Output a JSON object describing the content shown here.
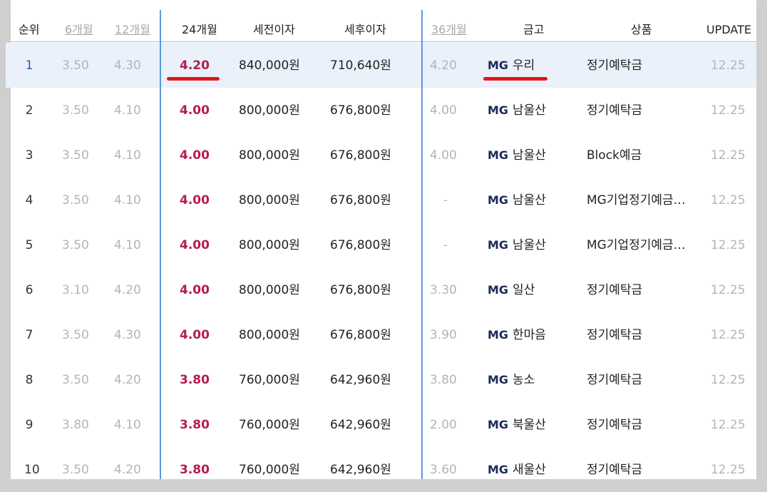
{
  "columns": {
    "rank": "순위",
    "m6": "6개월",
    "m12": "12개월",
    "m24": "24개월",
    "pretax": "세전이자",
    "aftertax": "세후이자",
    "m36": "36개월",
    "bank": "금고",
    "product": "상품",
    "update": "UPDATE"
  },
  "rows": [
    {
      "rank": "1",
      "m6": "3.50",
      "m12": "4.30",
      "m24": "4.20",
      "pretax": "840,000원",
      "aftertax": "710,640원",
      "m36": "4.20",
      "logo": "MG",
      "bank": "우리",
      "product": "정기예탁금",
      "update": "12.25"
    },
    {
      "rank": "2",
      "m6": "3.50",
      "m12": "4.10",
      "m24": "4.00",
      "pretax": "800,000원",
      "aftertax": "676,800원",
      "m36": "4.00",
      "logo": "MG",
      "bank": "남울산",
      "product": "정기예탁금",
      "update": "12.25"
    },
    {
      "rank": "3",
      "m6": "3.50",
      "m12": "4.10",
      "m24": "4.00",
      "pretax": "800,000원",
      "aftertax": "676,800원",
      "m36": "4.00",
      "logo": "MG",
      "bank": "남울산",
      "product": "Block예금",
      "update": "12.25"
    },
    {
      "rank": "4",
      "m6": "3.50",
      "m12": "4.10",
      "m24": "4.00",
      "pretax": "800,000원",
      "aftertax": "676,800원",
      "m36": "-",
      "logo": "MG",
      "bank": "남울산",
      "product": "MG기업정기예금…",
      "update": "12.25"
    },
    {
      "rank": "5",
      "m6": "3.50",
      "m12": "4.10",
      "m24": "4.00",
      "pretax": "800,000원",
      "aftertax": "676,800원",
      "m36": "-",
      "logo": "MG",
      "bank": "남울산",
      "product": "MG기업정기예금…",
      "update": "12.25"
    },
    {
      "rank": "6",
      "m6": "3.10",
      "m12": "4.20",
      "m24": "4.00",
      "pretax": "800,000원",
      "aftertax": "676,800원",
      "m36": "3.30",
      "logo": "MG",
      "bank": "일산",
      "product": "정기예탁금",
      "update": "12.25"
    },
    {
      "rank": "7",
      "m6": "3.50",
      "m12": "4.30",
      "m24": "4.00",
      "pretax": "800,000원",
      "aftertax": "676,800원",
      "m36": "3.90",
      "logo": "MG",
      "bank": "한마음",
      "product": "정기예탁금",
      "update": "12.25"
    },
    {
      "rank": "8",
      "m6": "3.50",
      "m12": "4.20",
      "m24": "3.80",
      "pretax": "760,000원",
      "aftertax": "642,960원",
      "m36": "3.80",
      "logo": "MG",
      "bank": "농소",
      "product": "정기예탁금",
      "update": "12.25"
    },
    {
      "rank": "9",
      "m6": "3.80",
      "m12": "4.10",
      "m24": "3.80",
      "pretax": "760,000원",
      "aftertax": "642,960원",
      "m36": "2.00",
      "logo": "MG",
      "bank": "북울산",
      "product": "정기예탁금",
      "update": "12.25"
    },
    {
      "rank": "10",
      "m6": "3.50",
      "m12": "4.20",
      "m24": "3.80",
      "pretax": "760,000원",
      "aftertax": "642,960원",
      "m36": "3.60",
      "logo": "MG",
      "bank": "새울산",
      "product": "정기예탁금",
      "update": "12.25"
    }
  ],
  "colors": {
    "accent_rate": "#b51d4a",
    "divider": "#5a98e0",
    "highlight_row": "#eaf1fb",
    "annotation": "#e01818"
  }
}
